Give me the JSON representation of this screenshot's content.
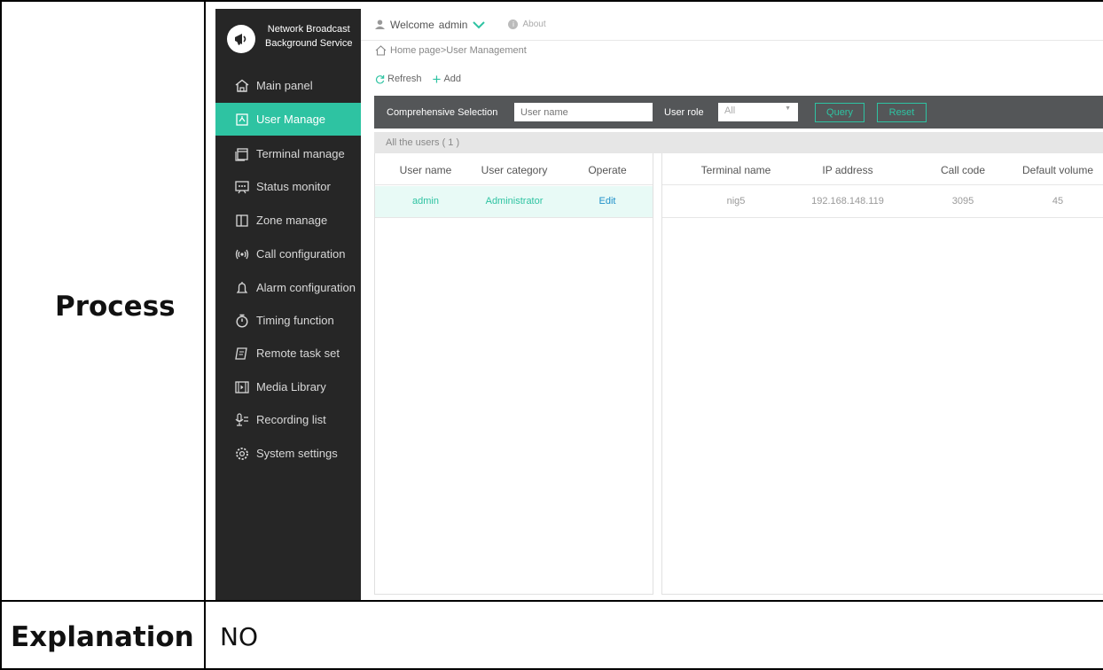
{
  "document": {
    "row1_label": "Process",
    "row2_label": "Explanation",
    "row2_value": "NO"
  },
  "app": {
    "brand_line1": "Network Broadcast",
    "brand_line2": "Background Service",
    "welcome_prefix": "Welcome",
    "user": "admin",
    "about": "About",
    "breadcrumb": "Home page>User Management",
    "toolbar": {
      "refresh": "Refresh",
      "add": "Add"
    },
    "accent_color": "#2ec3a2",
    "sidebar_bg": "#262626",
    "nav": [
      {
        "label": "Main panel",
        "icon": "home-icon",
        "active": false
      },
      {
        "label": "User Manage",
        "icon": "user-manage-icon",
        "active": true
      },
      {
        "label": "Terminal manage",
        "icon": "terminal-icon",
        "active": false
      },
      {
        "label": "Status monitor",
        "icon": "monitor-icon",
        "active": false
      },
      {
        "label": "Zone manage",
        "icon": "zone-icon",
        "active": false
      },
      {
        "label": "Call configuration",
        "icon": "broadcast-icon",
        "active": false
      },
      {
        "label": "Alarm configuration",
        "icon": "bell-icon",
        "active": false
      },
      {
        "label": "Timing function",
        "icon": "timer-icon",
        "active": false
      },
      {
        "label": "Remote task set",
        "icon": "task-icon",
        "active": false
      },
      {
        "label": "Media Library",
        "icon": "media-icon",
        "active": false
      },
      {
        "label": "Recording list",
        "icon": "microphone-icon",
        "active": false
      },
      {
        "label": "System settings",
        "icon": "gear-icon",
        "active": false
      }
    ],
    "filter": {
      "title": "Comprehensive Selection",
      "username_placeholder": "User name",
      "role_label": "User role",
      "role_value": "All",
      "query": "Query",
      "reset": "Reset"
    },
    "all_users": "All the users ( 1 )",
    "users_table": {
      "headers": [
        "User name",
        "User category",
        "Operate"
      ],
      "rows": [
        [
          "admin",
          "Administrator",
          "Edit"
        ]
      ]
    },
    "terminals_table": {
      "headers": [
        "Terminal name",
        "IP address",
        "Call code",
        "Default volume"
      ],
      "rows": [
        [
          "nig5",
          "192.168.148.119",
          "3095",
          "45"
        ]
      ]
    }
  }
}
